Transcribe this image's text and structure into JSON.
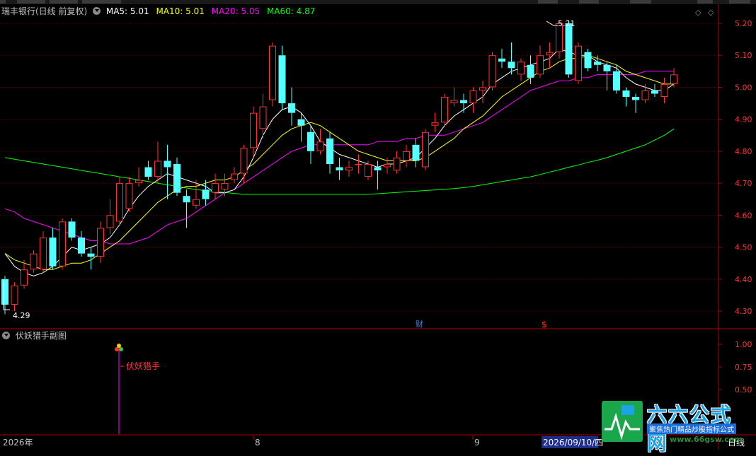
{
  "header": {
    "stock_title": "瑞丰银行(日线 前复权)",
    "ma5_label": "MA5: 5.01",
    "ma10_label": "MA10: 5.01",
    "ma20_label": "MA20: 5.05",
    "ma60_label": "MA60: 4.87"
  },
  "sub_indicator": {
    "title": "伏妖猎手副图",
    "signal_label": "伏妖猎手"
  },
  "price_axis": [
    "5.20",
    "5.10",
    "5.00",
    "4.90",
    "4.80",
    "4.70",
    "4.60",
    "4.50",
    "4.40",
    "4.30"
  ],
  "indicator_axis": [
    "1.00",
    "0.75",
    "0.50"
  ],
  "markers": {
    "high_label": "5.21",
    "low_label": "4.29",
    "finance_label": "财",
    "dividend_label": "$"
  },
  "time_axis": {
    "year_label": "2026年",
    "month8": "8",
    "month9": "9",
    "cursor_date": "2026/09/10/四"
  },
  "period_label": "日线",
  "logo": {
    "title": "六六公式网",
    "slogan": "聚焦热门精品炒股指标公式",
    "url": "www.66gsw.com"
  },
  "colors": {
    "up": "#ff3232",
    "down": "#54ffff",
    "ma5": "#ffffff",
    "ma10": "#ffff00",
    "ma20": "#ff00ff",
    "ma60": "#00ff00",
    "frame": "#b00000"
  },
  "chart_data": {
    "type": "candlestick",
    "ylim": [
      4.27,
      5.22
    ],
    "candles": [
      [
        4.4,
        4.32,
        4.41,
        4.29
      ],
      [
        4.32,
        4.38,
        4.39,
        4.3
      ],
      [
        4.38,
        4.43,
        4.46,
        4.37
      ],
      [
        4.43,
        4.48,
        4.49,
        4.42
      ],
      [
        4.43,
        4.53,
        4.55,
        4.42
      ],
      [
        4.53,
        4.44,
        4.56,
        4.43
      ],
      [
        4.44,
        4.58,
        4.59,
        4.43
      ],
      [
        4.58,
        4.53,
        4.59,
        4.52
      ],
      [
        4.53,
        4.48,
        4.55,
        4.47
      ],
      [
        4.48,
        4.47,
        4.5,
        4.43
      ],
      [
        4.47,
        4.56,
        4.58,
        4.45
      ],
      [
        4.56,
        4.6,
        4.65,
        4.54
      ],
      [
        4.58,
        4.7,
        4.72,
        4.57
      ],
      [
        4.62,
        4.7,
        4.72,
        4.61
      ],
      [
        4.7,
        4.71,
        4.75,
        4.69
      ],
      [
        4.75,
        4.72,
        4.77,
        4.71
      ],
      [
        4.72,
        4.77,
        4.83,
        4.7
      ],
      [
        4.77,
        4.75,
        4.82,
        4.65
      ],
      [
        4.76,
        4.67,
        4.78,
        4.66
      ],
      [
        4.66,
        4.64,
        4.68,
        4.56
      ],
      [
        4.63,
        4.65,
        4.71,
        4.62
      ],
      [
        4.68,
        4.65,
        4.71,
        4.63
      ],
      [
        4.67,
        4.7,
        4.73,
        4.65
      ],
      [
        4.68,
        4.7,
        4.73,
        4.66
      ],
      [
        4.71,
        4.73,
        4.75,
        4.7
      ],
      [
        4.73,
        4.81,
        4.82,
        4.7
      ],
      [
        4.81,
        4.92,
        4.94,
        4.78
      ],
      [
        4.87,
        4.94,
        4.98,
        4.84
      ],
      [
        4.96,
        5.13,
        5.14,
        4.94
      ],
      [
        5.1,
        4.95,
        5.13,
        4.93
      ],
      [
        4.95,
        4.92,
        5.0,
        4.88
      ],
      [
        4.9,
        4.88,
        4.92,
        4.83
      ],
      [
        4.86,
        4.8,
        4.88,
        4.76
      ],
      [
        4.8,
        4.83,
        4.87,
        4.79
      ],
      [
        4.84,
        4.76,
        4.86,
        4.73
      ],
      [
        4.75,
        4.74,
        4.78,
        4.71
      ],
      [
        4.74,
        4.75,
        4.77,
        4.72
      ],
      [
        4.76,
        4.76,
        4.79,
        4.73
      ],
      [
        4.72,
        4.76,
        4.77,
        4.71
      ],
      [
        4.75,
        4.74,
        4.77,
        4.68
      ],
      [
        4.75,
        4.76,
        4.78,
        4.73
      ],
      [
        4.74,
        4.78,
        4.8,
        4.73
      ],
      [
        4.77,
        4.8,
        4.82,
        4.75
      ],
      [
        4.82,
        4.77,
        4.84,
        4.75
      ],
      [
        4.75,
        4.86,
        4.87,
        4.74
      ],
      [
        4.88,
        4.89,
        4.92,
        4.86
      ],
      [
        4.89,
        4.97,
        4.98,
        4.88
      ],
      [
        4.95,
        4.96,
        5.0,
        4.94
      ],
      [
        4.96,
        4.95,
        4.98,
        4.92
      ],
      [
        4.95,
        4.99,
        5.0,
        4.92
      ],
      [
        4.99,
        5.0,
        5.02,
        4.95
      ],
      [
        5.0,
        5.1,
        5.11,
        4.99
      ],
      [
        5.09,
        5.08,
        5.12,
        5.06
      ],
      [
        5.08,
        5.06,
        5.14,
        5.04
      ],
      [
        5.04,
        5.08,
        5.09,
        5.02
      ],
      [
        5.07,
        5.03,
        5.1,
        5.01
      ],
      [
        5.04,
        5.1,
        5.13,
        5.03
      ],
      [
        5.1,
        5.11,
        5.14,
        5.06
      ],
      [
        5.11,
        5.2,
        5.21,
        5.09
      ],
      [
        5.2,
        5.04,
        5.21,
        5.03
      ],
      [
        5.02,
        5.13,
        5.14,
        5.01
      ],
      [
        5.11,
        5.06,
        5.12,
        5.05
      ],
      [
        5.08,
        5.07,
        5.1,
        5.05
      ],
      [
        5.07,
        5.05,
        5.08,
        4.99
      ],
      [
        5.05,
        4.99,
        5.07,
        4.98
      ],
      [
        4.99,
        4.97,
        5.0,
        4.94
      ],
      [
        4.97,
        4.96,
        4.98,
        4.92
      ],
      [
        4.96,
        4.99,
        5.01,
        4.95
      ],
      [
        4.99,
        4.98,
        5.01,
        4.97
      ],
      [
        4.97,
        5.01,
        5.03,
        4.95
      ],
      [
        5.01,
        5.04,
        5.06,
        5.0
      ]
    ],
    "ma5": [
      4.48,
      4.44,
      4.42,
      4.41,
      4.42,
      4.44,
      4.47,
      4.5,
      4.49,
      4.5,
      4.51,
      4.53,
      4.57,
      4.62,
      4.66,
      4.69,
      4.71,
      4.73,
      4.72,
      4.71,
      4.7,
      4.69,
      4.67,
      4.67,
      4.68,
      4.72,
      4.78,
      4.85,
      4.9,
      4.93,
      4.94,
      4.92,
      4.88,
      4.83,
      4.81,
      4.79,
      4.78,
      4.77,
      4.76,
      4.75,
      4.76,
      4.76,
      4.77,
      4.78,
      4.81,
      4.84,
      4.88,
      4.91,
      4.93,
      4.95,
      4.97,
      5.01,
      5.03,
      5.05,
      5.06,
      5.07,
      5.08,
      5.09,
      5.12,
      5.11,
      5.1,
      5.1,
      5.08,
      5.07,
      5.06,
      5.03,
      5.01,
      5.0,
      4.99,
      4.99,
      5.01
    ],
    "ma10": [
      4.48,
      4.46,
      4.45,
      4.44,
      4.43,
      4.43,
      4.44,
      4.45,
      4.45,
      4.46,
      4.48,
      4.5,
      4.52,
      4.55,
      4.58,
      4.61,
      4.64,
      4.66,
      4.68,
      4.69,
      4.69,
      4.7,
      4.71,
      4.71,
      4.72,
      4.74,
      4.76,
      4.79,
      4.82,
      4.85,
      4.87,
      4.88,
      4.89,
      4.88,
      4.86,
      4.84,
      4.82,
      4.8,
      4.79,
      4.78,
      4.77,
      4.77,
      4.77,
      4.77,
      4.78,
      4.8,
      4.82,
      4.84,
      4.87,
      4.89,
      4.91,
      4.94,
      4.97,
      4.99,
      5.01,
      5.03,
      5.05,
      5.06,
      5.08,
      5.09,
      5.09,
      5.1,
      5.09,
      5.08,
      5.07,
      5.05,
      5.04,
      5.03,
      5.02,
      5.01,
      5.01
    ],
    "ma20": [
      4.62,
      4.61,
      4.59,
      4.58,
      4.57,
      4.56,
      4.55,
      4.54,
      4.53,
      4.52,
      4.52,
      4.51,
      4.51,
      4.51,
      4.52,
      4.53,
      4.55,
      4.57,
      4.58,
      4.59,
      4.61,
      4.63,
      4.65,
      4.67,
      4.68,
      4.7,
      4.72,
      4.74,
      4.76,
      4.78,
      4.8,
      4.81,
      4.82,
      4.82,
      4.82,
      4.82,
      4.82,
      4.82,
      4.82,
      4.83,
      4.83,
      4.83,
      4.84,
      4.84,
      4.85,
      4.85,
      4.85,
      4.86,
      4.87,
      4.88,
      4.89,
      4.91,
      4.93,
      4.95,
      4.97,
      4.99,
      5.0,
      5.01,
      5.02,
      5.02,
      5.03,
      5.03,
      5.04,
      5.04,
      5.04,
      5.04,
      5.04,
      5.05,
      5.05,
      5.05,
      5.05
    ],
    "ma60": [
      4.78,
      4.775,
      4.77,
      4.765,
      4.76,
      4.755,
      4.75,
      4.745,
      4.74,
      4.735,
      4.73,
      4.725,
      4.72,
      4.715,
      4.71,
      4.705,
      4.7,
      4.695,
      4.69,
      4.685,
      4.68,
      4.677,
      4.674,
      4.671,
      4.668,
      4.665,
      4.665,
      4.665,
      4.665,
      4.665,
      4.665,
      4.665,
      4.665,
      4.665,
      4.665,
      4.665,
      4.665,
      4.665,
      4.665,
      4.667,
      4.669,
      4.671,
      4.673,
      4.675,
      4.677,
      4.679,
      4.681,
      4.683,
      4.686,
      4.69,
      4.695,
      4.7,
      4.705,
      4.71,
      4.715,
      4.72,
      4.727,
      4.735,
      4.742,
      4.75,
      4.757,
      4.765,
      4.772,
      4.78,
      4.79,
      4.8,
      4.81,
      4.82,
      4.835,
      4.85,
      4.87
    ],
    "signal": {
      "index": 11,
      "value": 1.0
    }
  }
}
